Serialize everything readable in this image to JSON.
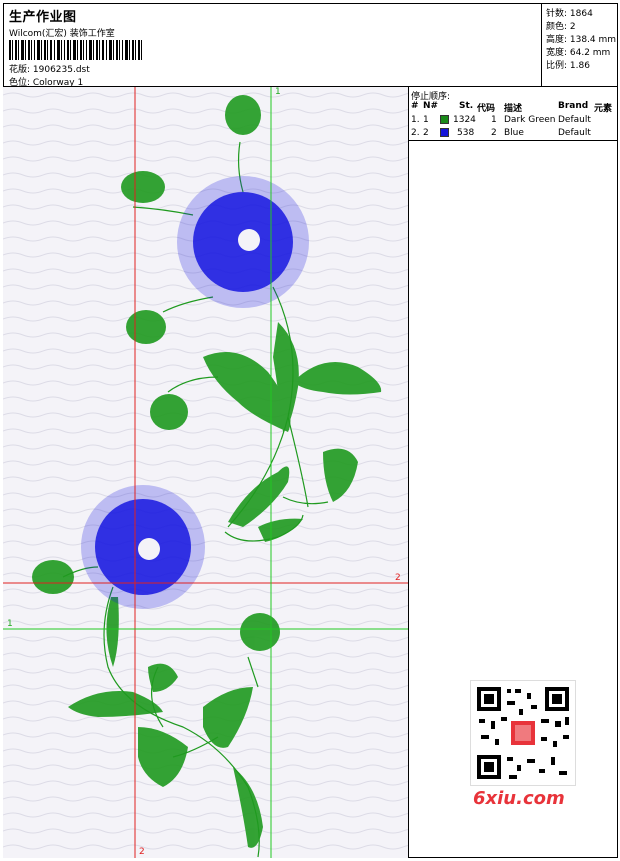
{
  "header": {
    "title": "生产作业图",
    "company": "Wilcom(汇宏) 装饰工作室",
    "design_label": "花版: 1906235.dst",
    "colorway_label": "色位: Colorway 1"
  },
  "specs": [
    "针数: 1864",
    "颜色: 2",
    "高度: 138.4 mm",
    "宽度: 64.2 mm",
    "比例: 1.86"
  ],
  "stop_sequence": {
    "title": "停止顺序:",
    "columns": [
      "#",
      "N#",
      "St.",
      "代码",
      "描述",
      "Brand",
      "元素"
    ],
    "rows": [
      {
        "index": "1.",
        "needle": "1",
        "color": "#1a8a1a",
        "stitches": "1324",
        "code": "1",
        "description": "Dark Green",
        "brand": "Default"
      },
      {
        "index": "2.",
        "needle": "2",
        "color": "#1414d8",
        "stitches": "538",
        "code": "2",
        "description": "Blue",
        "brand": "Default"
      }
    ]
  },
  "axis_labels": {
    "v_green_top": "1",
    "h_red_right": "2",
    "h_green_left": "1",
    "v_red_bottom": "2"
  },
  "colors": {
    "green_thread": "#1f9a1f",
    "blue_thread": "#1616e0",
    "guide_red": "#e02020",
    "guide_green": "#22c822"
  },
  "watermark": "6xiu.com"
}
